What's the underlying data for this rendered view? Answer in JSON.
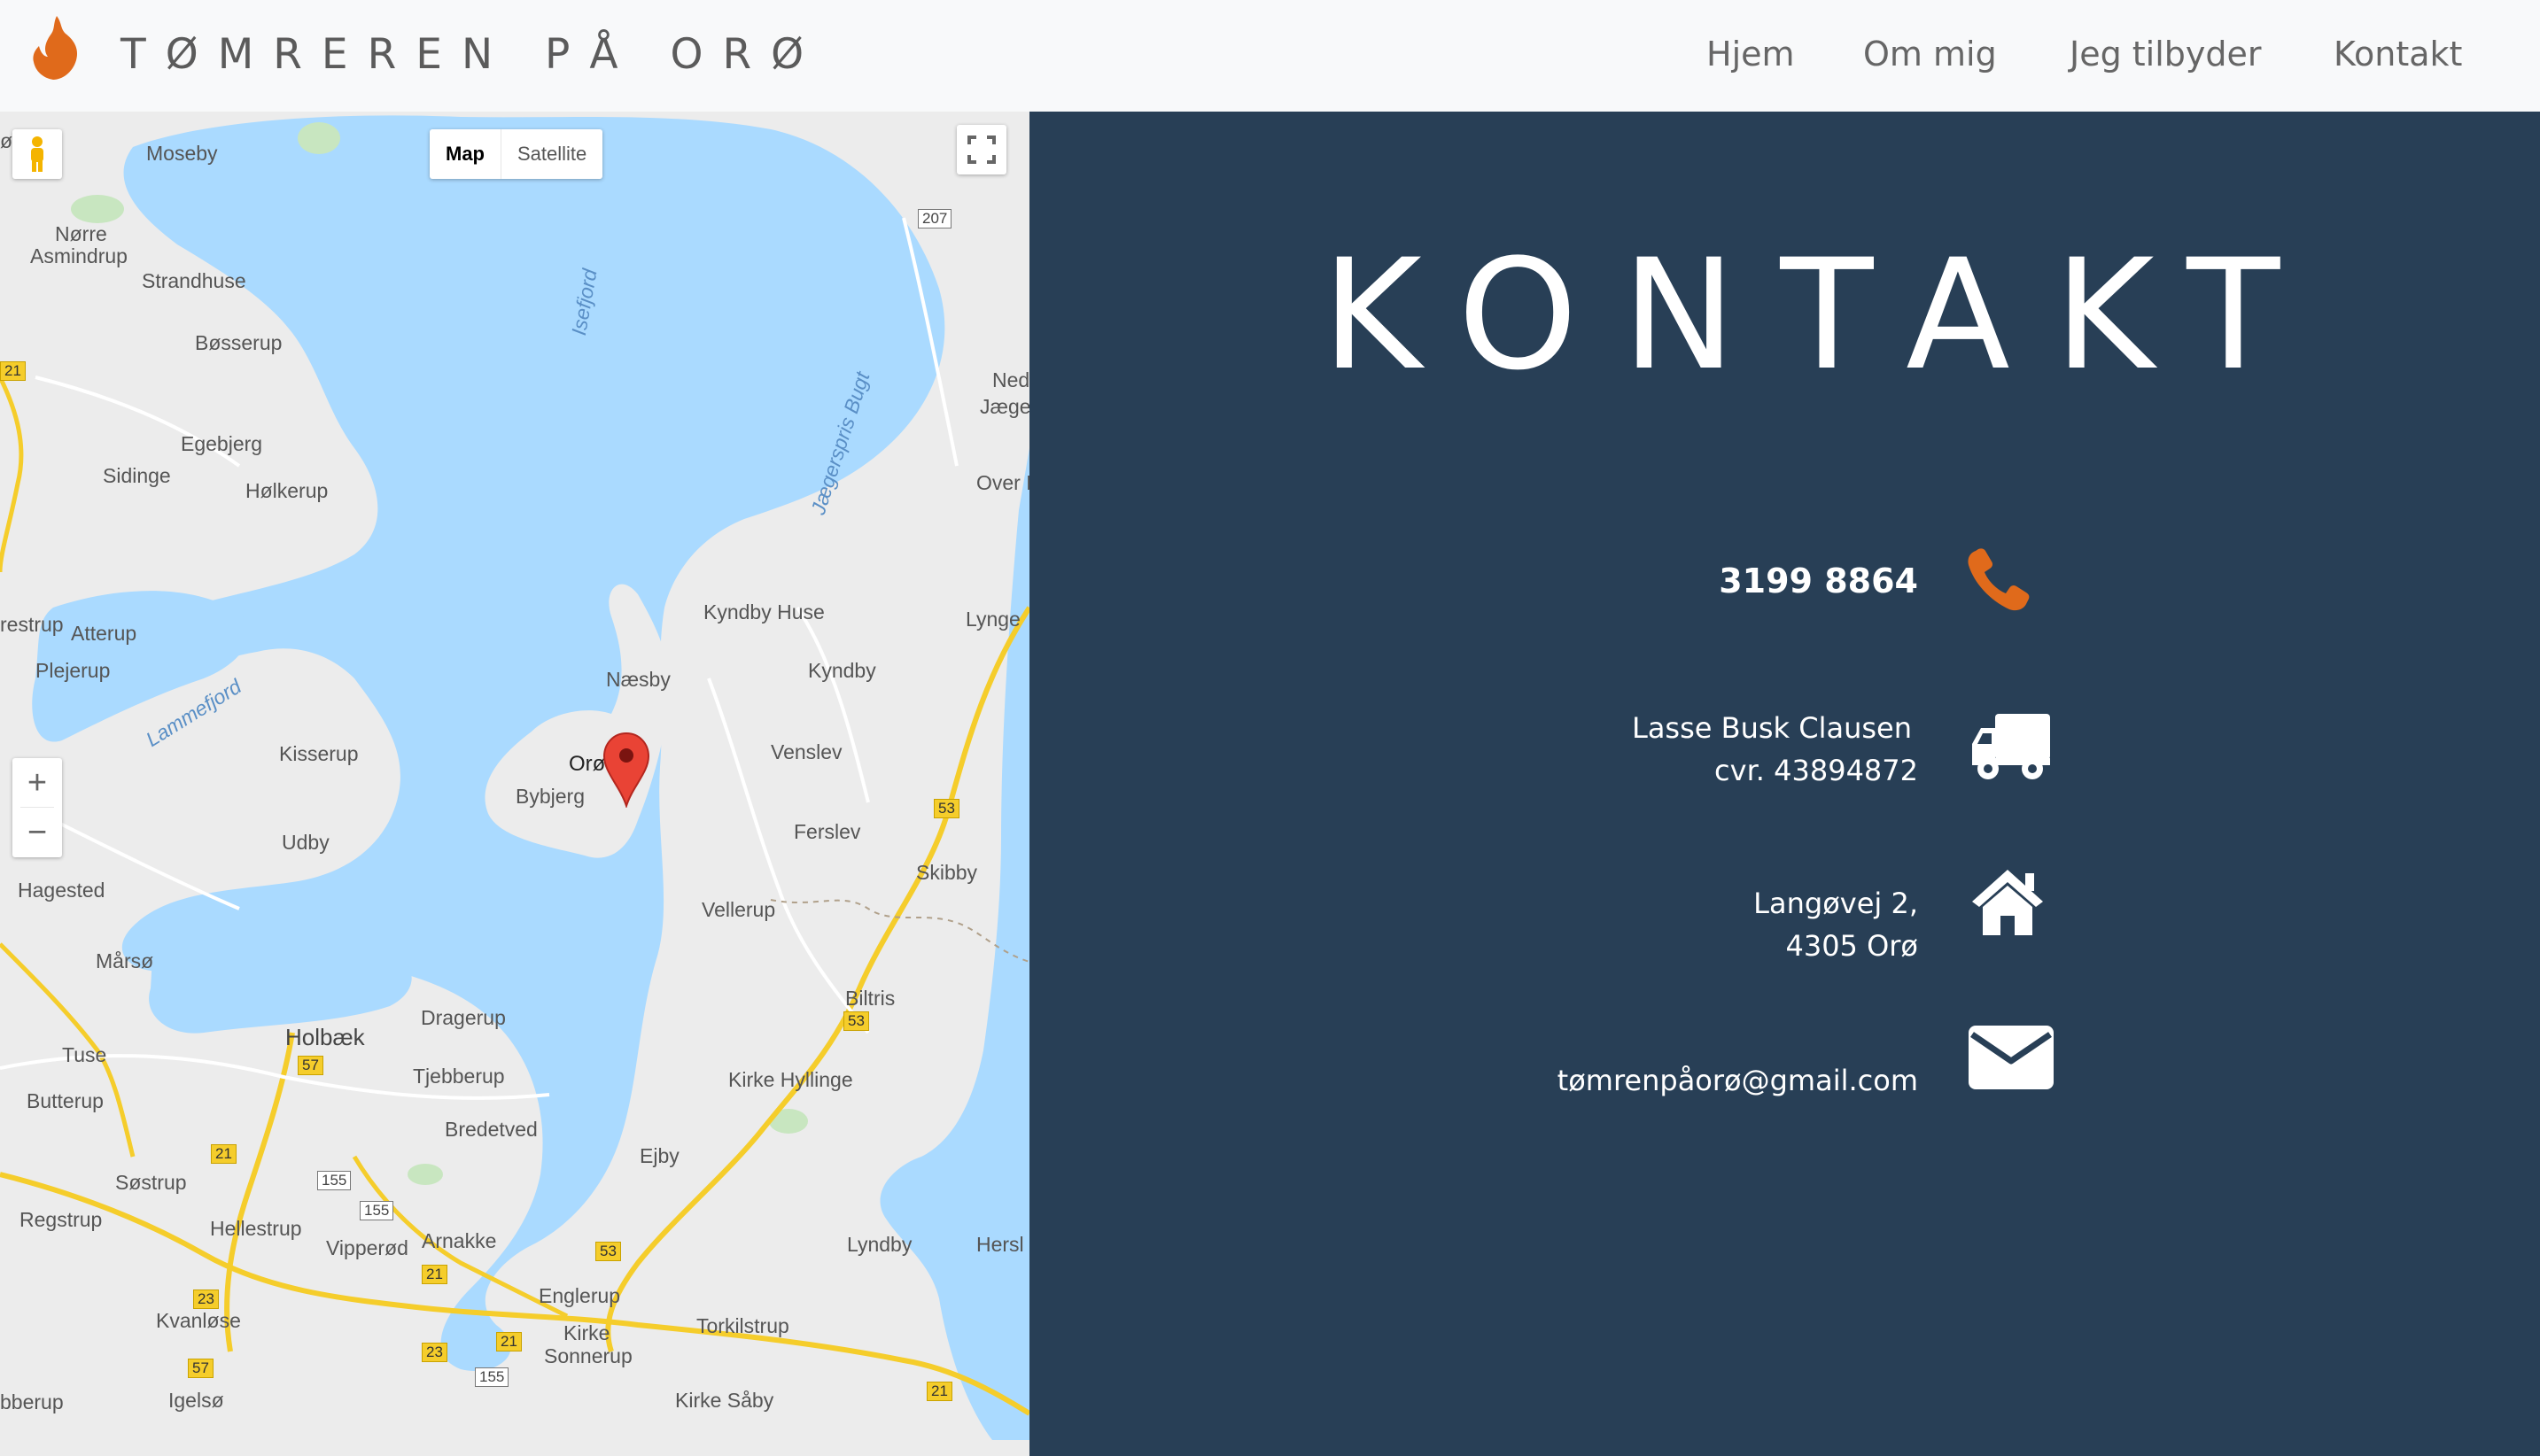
{
  "navbar": {
    "brand": "TØMREREN PÅ ORØ",
    "logo_icon": "flame-logo-icon",
    "items": [
      {
        "label": "Hjem"
      },
      {
        "label": "Om mig"
      },
      {
        "label": "Jeg tilbyder"
      },
      {
        "label": "Kontakt"
      }
    ]
  },
  "map": {
    "map_type": {
      "map_label": "Map",
      "satellite_label": "Satellite",
      "selected": "Map"
    },
    "zoom_in": "+",
    "zoom_out": "−",
    "places": [
      "Moseby",
      "Nørre",
      "Asmindrup",
      "Strandhuse",
      "Bøsserup",
      "Egebjerg",
      "Sidinge",
      "Hølkerup",
      "Atterup",
      "Plejerup",
      "Kisserup",
      "Udby",
      "Hagested",
      "Mårsø",
      "Holbæk",
      "Tuse",
      "Butterup",
      "Søstrup",
      "Regstrup",
      "Hellestrup",
      "Vipperød",
      "Arnakke",
      "Kvanløse",
      "Igelsø",
      "Dragerup",
      "Tjebberup",
      "Bredetved",
      "Ejby",
      "Englerup",
      "Kirke",
      "Sonnerup",
      "Torkilstrup",
      "Kirke Såby",
      "Næsby",
      "Orø",
      "Bybjerg",
      "Kyndby Huse",
      "Kyndby",
      "Venslev",
      "Ferslev",
      "Vellerup",
      "Skibby",
      "Biltris",
      "Kirke Hyllinge",
      "Lyndby",
      "Ned",
      "Jæge",
      "Over D",
      "Lynge",
      "Hersl",
      "ø",
      "restrup",
      "bberup"
    ],
    "water_labels": [
      "Isefjord",
      "Jægerspris Bugt",
      "Lammefjord"
    ],
    "road_numbers": [
      "207",
      "21",
      "53",
      "57",
      "155",
      "23"
    ],
    "marker_place": "Orø"
  },
  "contact": {
    "title": "KONTAKT",
    "phone": "3199 8864",
    "company_name": "Lasse Busk Clausen",
    "cvr": "cvr. 43894872",
    "address_line1": "Langøvej 2,",
    "address_line2": "4305 Orø",
    "email": "tømrenpåorø@gmail.com",
    "icons": [
      "phone-icon",
      "truck-icon",
      "home-icon",
      "envelope-icon"
    ],
    "accent_color": "#e06a1b",
    "background_color": "#283f56"
  }
}
